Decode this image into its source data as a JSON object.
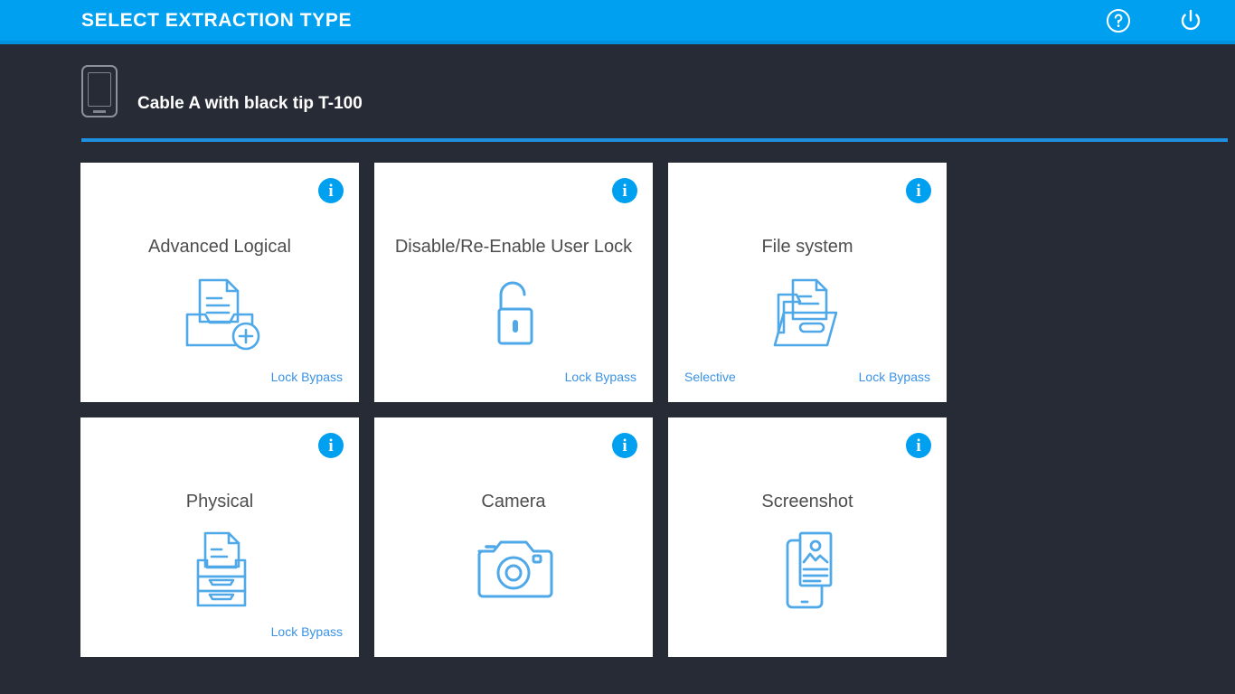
{
  "header": {
    "title": "SELECT EXTRACTION TYPE",
    "help_icon": "help-circle-icon",
    "power_icon": "power-icon",
    "background_color": "#00a0f0"
  },
  "device": {
    "icon": "mobile-device-icon",
    "name": "Cable A with black tip T-100"
  },
  "theme": {
    "background": "#272b35",
    "accent": "#00a0f0",
    "card_background": "#ffffff",
    "tag_color": "#3a92e5",
    "title_color": "#4d4d4d",
    "divider_color": "#1f8fe0"
  },
  "cards": [
    {
      "title": "Advanced Logical",
      "icon": "document-in-tray-add-icon",
      "info_icon": "info-icon",
      "tag_left": "",
      "tag_right": "Lock Bypass"
    },
    {
      "title": "Disable/Re-Enable User Lock",
      "icon": "open-padlock-icon",
      "info_icon": "info-icon",
      "tag_left": "",
      "tag_right": "Lock Bypass"
    },
    {
      "title": "File system",
      "icon": "open-folder-document-icon",
      "info_icon": "info-icon",
      "tag_left": "Selective",
      "tag_right": "Lock Bypass"
    },
    {
      "title": "Physical",
      "icon": "file-drawers-icon",
      "info_icon": "info-icon",
      "tag_left": "",
      "tag_right": "Lock Bypass"
    },
    {
      "title": "Camera",
      "icon": "camera-icon",
      "info_icon": "info-icon",
      "tag_left": "",
      "tag_right": ""
    },
    {
      "title": "Screenshot",
      "icon": "phone-screenshot-icon",
      "info_icon": "info-icon",
      "tag_left": "",
      "tag_right": ""
    }
  ],
  "info_glyph": "i"
}
